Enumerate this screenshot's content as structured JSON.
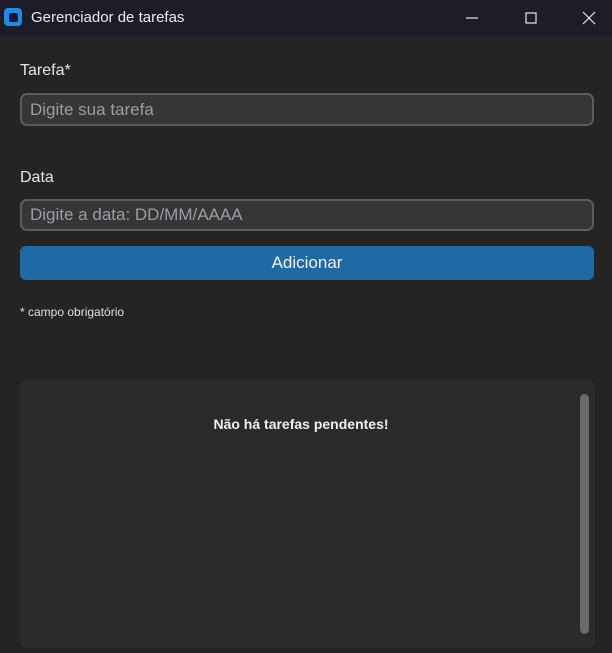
{
  "window": {
    "title": "Gerenciador de tarefas",
    "controls": [
      "minimize-icon",
      "maximize-icon",
      "close-icon"
    ]
  },
  "form": {
    "task_label": "Tarefa*",
    "task_placeholder": "Digite sua tarefa",
    "task_value": "",
    "date_label": "Data",
    "date_placeholder": "Digite a data: DD/MM/AAAA",
    "date_value": "",
    "add_button_label": "Adicionar",
    "required_note": "* campo obrigatório"
  },
  "task_list": {
    "empty_message": "Não há tarefas pendentes!"
  },
  "colors": {
    "background": "#242424",
    "titlebar": "#1c1d29",
    "accent_button": "#1f6aa5",
    "input_bg": "#343638",
    "panel_bg": "#2b2b2b",
    "app_icon": "#1f8be6"
  }
}
